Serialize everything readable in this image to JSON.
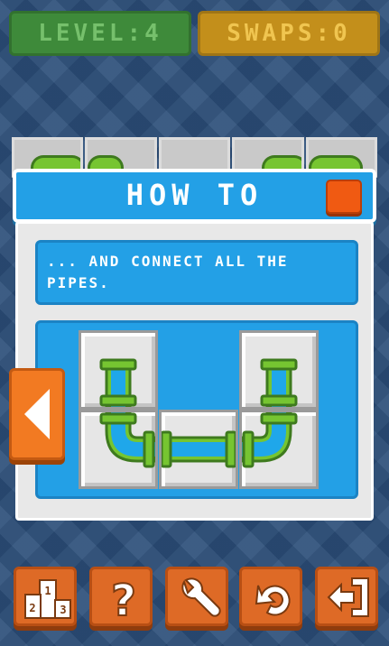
{
  "hud": {
    "level_label": "LEVEL:",
    "level_value": "4",
    "swaps_label": "SWAPS:",
    "swaps_value": "0"
  },
  "dialog": {
    "title": "HOW TO",
    "tip_text": "... AND CONNECT ALL THE PIPES."
  },
  "icons": {
    "close": "close-icon",
    "prev": "arrow-left-icon",
    "leaderboard": "podium-icon",
    "help": "question-icon",
    "settings": "wrench-icon",
    "undo": "undo-icon",
    "exit": "exit-icon"
  },
  "podium_numbers": [
    "1",
    "2",
    "3"
  ],
  "help_glyph": "?",
  "colors": {
    "dialog_blue": "#23a0e6",
    "pipe_green": "#76c531",
    "water_blue": "#1fa7ea",
    "button_orange": "#de6a26",
    "close_orange": "#f05a12",
    "level_green": "#3e8a3a",
    "swaps_yellow": "#c38f1b"
  }
}
